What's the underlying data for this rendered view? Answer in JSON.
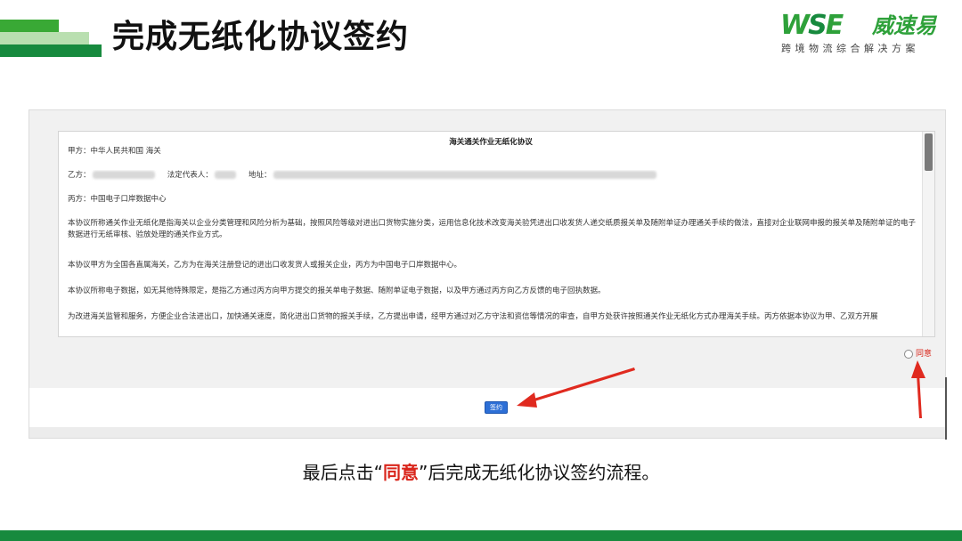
{
  "slide": {
    "title": "完成无纸化协议签约",
    "accent_color": "#178a3e",
    "highlight_color": "#d9261c"
  },
  "logo": {
    "mark_w": "W",
    "mark_s": "S",
    "mark_e": "E",
    "name_cn": "威速易",
    "tagline": "跨境物流综合解决方案"
  },
  "document": {
    "title": "海关通关作业无纸化协议",
    "party_a": "甲方：中华人民共和国        海关",
    "party_b_label": "乙方：",
    "legal_rep_label": "法定代表人：",
    "address_label": "地址：",
    "party_c": "丙方：中国电子口岸数据中心",
    "para1": "本协议所称通关作业无纸化是指海关以企业分类管理和风险分析为基础，按照风险等级对进出口货物实施分类，运用信息化技术改变海关验凭进出口收发货人递交纸质报关单及随附单证办理通关手续的做法，直接对企业联网申报的报关单及随附单证的电子数据进行无纸审核、验放处理的通关作业方式。",
    "para2": "本协议甲方为全国各直属海关，乙方为在海关注册登记的进出口收发货人或报关企业，丙方为中国电子口岸数据中心。",
    "para3": "本协议所称电子数据，如无其他特殊限定，是指乙方通过丙方向甲方提交的报关单电子数据、随附单证电子数据，以及甲方通过丙方向乙方反馈的电子回执数据。",
    "para4": "为改进海关监管和服务，方便企业合法进出口，加快通关速度，简化进出口货物的报关手续，乙方提出申请，经甲方通过对乙方守法和资信等情况的审查，自甲方处获许按照通关作业无纸化方式办理海关手续。丙方依据本协议为甲、乙双方开展"
  },
  "controls": {
    "agree_label": "同意",
    "sign_button": "签约"
  },
  "caption": {
    "before": "最后点击",
    "quote_open": "“",
    "highlight": "同意",
    "quote_close": "”",
    "after": "后完成无纸化协议签约流程。"
  }
}
